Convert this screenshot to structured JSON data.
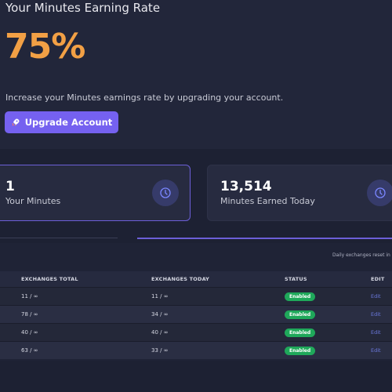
{
  "header": {
    "title": "Your Minutes Earning Rate",
    "rate": "75%",
    "description": "Increase your Minutes earnings rate by upgrading your account.",
    "upgrade_label": "Upgrade Account"
  },
  "cards": [
    {
      "value": "1",
      "label": "Your Minutes"
    },
    {
      "value": "13,514",
      "label": "Minutes Earned Today"
    }
  ],
  "exchanges": {
    "note": "Daily exchanges reset in",
    "columns": [
      "EXCHANGES TOTAL",
      "EXCHANGES TODAY",
      "STATUS",
      "EDIT"
    ],
    "rows": [
      {
        "total": "11 / ∞",
        "today": "11 / ∞",
        "status": "Enabled",
        "edit": "Edit"
      },
      {
        "total": "78 / ∞",
        "today": "34 / ∞",
        "status": "Enabled",
        "edit": "Edit"
      },
      {
        "total": "40 / ∞",
        "today": "40 / ∞",
        "status": "Enabled",
        "edit": "Edit"
      },
      {
        "total": "63 / ∞",
        "today": "33 / ∞",
        "status": "Enabled",
        "edit": "Edit"
      }
    ]
  },
  "colors": {
    "accent": "#7561f0",
    "rate": "#f2a045",
    "status_enabled": "#1fa85a",
    "link": "#6c7ae0"
  }
}
